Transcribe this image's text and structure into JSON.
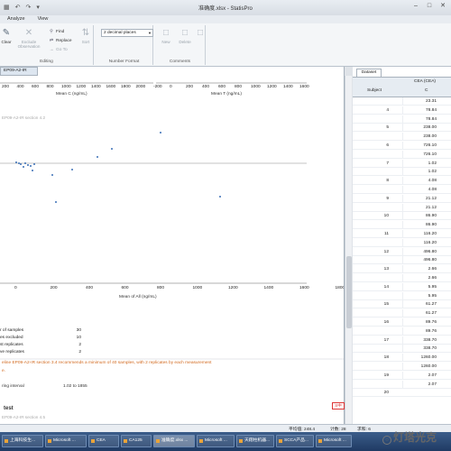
{
  "window": {
    "title": "准确度.xlsx - StatisPro",
    "quick_access": [
      "▦",
      "↶",
      "↷",
      "▾"
    ],
    "controls": [
      "–",
      "□",
      "✕"
    ]
  },
  "ribbon_tabs": [
    "Analyze",
    "View"
  ],
  "ribbon": {
    "edit": {
      "clear": "Clear",
      "exclude": "Exclude Observation",
      "find": "Find",
      "replace": "Replace",
      "goto": "Go To",
      "sort": "Sort",
      "label": "Editing"
    },
    "number": {
      "format_value": "2 decimal places",
      "label": "Number Format"
    },
    "comments": {
      "new": "New",
      "delete": "Delete",
      "label": "Comments"
    }
  },
  "report": {
    "tab_label": "EP09-A2-IR",
    "top_x_ticks": [
      "200",
      "400",
      "600",
      "800",
      "1000",
      "1200",
      "1400",
      "1600",
      "1800",
      "2000"
    ],
    "top_x_label": "Mean C (ng/mL)",
    "top_x2_ticks": [
      "-200",
      "0",
      "200",
      "400",
      "600",
      "800",
      "1000",
      "1200",
      "1400",
      "1600"
    ],
    "top_x2_label": "Mean T (ng/mL)",
    "section_label_1": "EP09-A2-IR section 4.2",
    "mid_x_ticks": [
      "0",
      "200",
      "400",
      "600",
      "800",
      "1000",
      "1200",
      "1400",
      "1600",
      "1800"
    ],
    "mid_x_label": "Mean of All (ng/mL)",
    "stats": [
      {
        "k": "r of samples",
        "v": "30"
      },
      {
        "k": "es excluded",
        "v": "10"
      },
      {
        "k": "st replicates",
        "v": "2"
      },
      {
        "k": "ve replicates",
        "v": "2"
      }
    ],
    "warning_1": "eline EP09-A2-IR section 3.4 recommends a minimum of 40 samples, with 2 replicates by each measurement",
    "warning_1b": "e.",
    "interval_label": "ring interval",
    "interval_value": "1.02 to 1855",
    "test_heading": "test",
    "section_label_2": "EP09-A2-IR section 4.5",
    "r_label": "r",
    "r_value": "0.965",
    "warning_2": "ndicates that the error in X is not adequately compensated by the measuring range.",
    "warning_2b": "mmends use of partitioned biases."
  },
  "dataset": {
    "tab": "Dataset",
    "col_header": "CEA (CEA)",
    "col_sub": "C",
    "subject_header": "Subject",
    "rows": [
      {
        "s": "",
        "v": "23.31"
      },
      {
        "s": "4",
        "v": "78.84"
      },
      {
        "s": "",
        "v": "78.84"
      },
      {
        "s": "5",
        "v": "238.00"
      },
      {
        "s": "",
        "v": "238.00"
      },
      {
        "s": "6",
        "v": "726.10"
      },
      {
        "s": "",
        "v": "726.10"
      },
      {
        "s": "7",
        "v": "1.02"
      },
      {
        "s": "",
        "v": "1.02"
      },
      {
        "s": "8",
        "v": "4.08"
      },
      {
        "s": "",
        "v": "4.08"
      },
      {
        "s": "9",
        "v": "21.12"
      },
      {
        "s": "",
        "v": "21.12"
      },
      {
        "s": "10",
        "v": "86.90"
      },
      {
        "s": "",
        "v": "86.90"
      },
      {
        "s": "11",
        "v": "116.20"
      },
      {
        "s": "",
        "v": "116.20"
      },
      {
        "s": "12",
        "v": "496.80"
      },
      {
        "s": "",
        "v": "496.80"
      },
      {
        "s": "13",
        "v": "2.66"
      },
      {
        "s": "",
        "v": "2.66"
      },
      {
        "s": "14",
        "v": "5.95"
      },
      {
        "s": "",
        "v": "5.95"
      },
      {
        "s": "15",
        "v": "61.27"
      },
      {
        "s": "",
        "v": "61.27"
      },
      {
        "s": "16",
        "v": "89.76"
      },
      {
        "s": "",
        "v": "89.76"
      },
      {
        "s": "17",
        "v": "338.70"
      },
      {
        "s": "",
        "v": "338.70"
      },
      {
        "s": "18",
        "v": "1260.00"
      },
      {
        "s": "",
        "v": "1260.00"
      },
      {
        "s": "19",
        "v": "2.07"
      },
      {
        "s": "",
        "v": "2.07"
      },
      {
        "s": "20",
        "v": ""
      }
    ]
  },
  "status": {
    "avg": "平均值: 248.4",
    "count": "计数: 28",
    "sum": "求和: 6"
  },
  "taskbar": [
    "上海科技生...",
    "Microsoft ...",
    "CEA",
    "CA125",
    "准确度.xlsx ...",
    "Microsoft ...",
    "天翔柱机器...",
    "SCCA产品...",
    "Microsoft ..."
  ],
  "watermark": "灯塔光克",
  "ime": "S中",
  "colors": {
    "accent": "#1f3a63",
    "warning": "#d2691e",
    "point": "#3a6fb7"
  }
}
